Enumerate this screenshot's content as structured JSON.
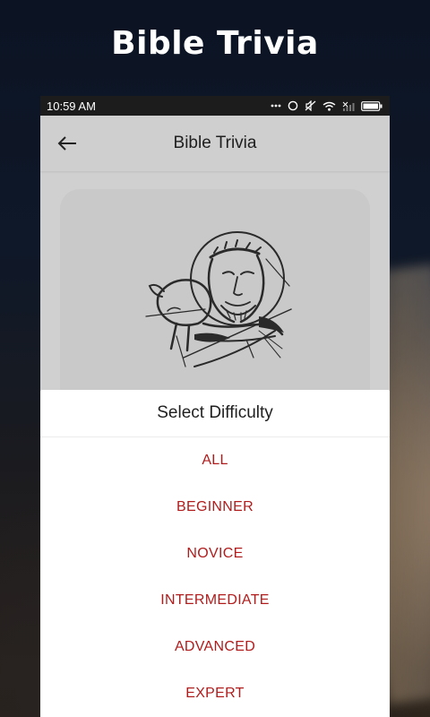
{
  "promo": {
    "title": "Bible Trivia"
  },
  "status_bar": {
    "time": "10:59 AM",
    "icons": [
      "more-dots-icon",
      "alarm-icon",
      "mute-icon",
      "wifi-icon",
      "signal-icon",
      "battery-icon"
    ]
  },
  "app_bar": {
    "back_icon": "arrow-left-icon",
    "title": "Bible Trivia"
  },
  "illustration": {
    "icon": "jesus-with-lamb-sketch"
  },
  "difficulty_sheet": {
    "title": "Select Difficulty",
    "options": [
      "ALL",
      "BEGINNER",
      "NOVICE",
      "INTERMEDIATE",
      "ADVANCED",
      "EXPERT"
    ]
  },
  "colors": {
    "option_text": "#b01c1c",
    "app_bar": "#cfcfcf",
    "status_bar": "#1c1c1c"
  }
}
